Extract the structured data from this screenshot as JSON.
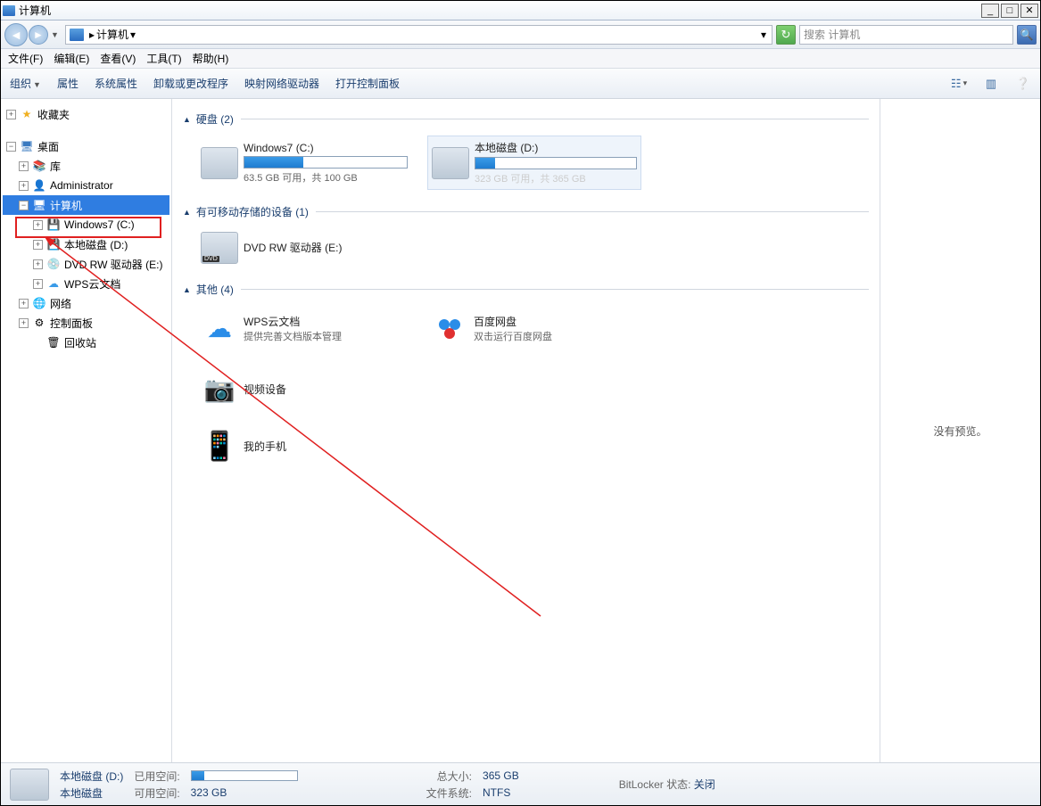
{
  "window": {
    "title": "计算机"
  },
  "window_controls": {
    "min": "_",
    "max": "□",
    "close": "✕"
  },
  "nav": {
    "breadcrumb_root": "计算机",
    "search_placeholder": "搜索 计算机"
  },
  "menu": {
    "file": "文件(F)",
    "edit": "编辑(E)",
    "view": "查看(V)",
    "tools": "工具(T)",
    "help": "帮助(H)"
  },
  "toolbar": {
    "organize": "组织",
    "properties": "属性",
    "sys_props": "系统属性",
    "uninstall": "卸载或更改程序",
    "map_network": "映射网络驱动器",
    "control_panel": "打开控制面板"
  },
  "tree": {
    "favorites": "收藏夹",
    "desktop": "桌面",
    "libraries": "库",
    "admin": "Administrator",
    "computer": "计算机",
    "win7": "Windows7 (C:)",
    "local_d": "本地磁盘 (D:)",
    "dvd": "DVD RW 驱动器 (E:)",
    "wps": "WPS云文档",
    "network": "网络",
    "control": "控制面板",
    "recycle": "回收站"
  },
  "groups": {
    "drives": {
      "label": "硬盘 (2)"
    },
    "removable": {
      "label": "有可移动存储的设备 (1)"
    },
    "other": {
      "label": "其他 (4)"
    }
  },
  "drives": {
    "c": {
      "name": "Windows7 (C:)",
      "sub": "63.5 GB 可用，共 100 GB",
      "fill_pct": 36
    },
    "d": {
      "name": "本地磁盘 (D:)",
      "sub": "323 GB 可用，共 365 GB",
      "fill_pct": 12
    },
    "dvd": {
      "name": "DVD RW 驱动器 (E:)"
    }
  },
  "other": {
    "wps": {
      "name": "WPS云文档",
      "sub": "提供完善文档版本管理"
    },
    "baidu": {
      "name": "百度网盘",
      "sub": "双击运行百度网盘"
    },
    "video": {
      "name": "视频设备",
      "sub": ""
    },
    "phone": {
      "name": "我的手机",
      "sub": ""
    }
  },
  "preview": {
    "none": "没有预览。"
  },
  "status": {
    "title": "本地磁盘 (D:)",
    "type": "本地磁盘",
    "used_label": "已用空间:",
    "free_label": "可用空间:",
    "free_val": "323 GB",
    "total_label": "总大小:",
    "total_val": "365 GB",
    "fs_label": "文件系统:",
    "fs_val": "NTFS",
    "bitlocker_label": "BitLocker 状态:",
    "bitlocker_val": "关闭",
    "used_fill_pct": 12
  }
}
